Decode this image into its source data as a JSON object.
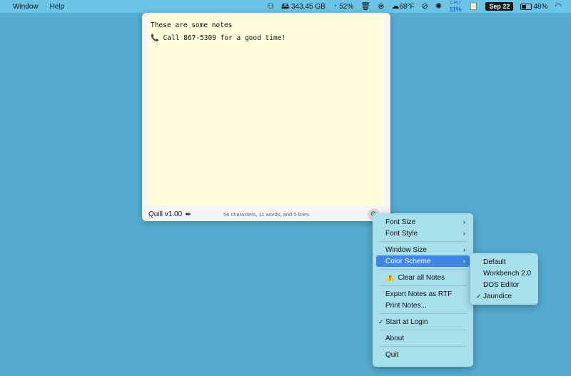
{
  "menubar": {
    "menus": [
      "Window",
      "Help"
    ],
    "disk": "343.45 GB",
    "cpu_percent": "52%",
    "temperature": "68°F",
    "cpu_label": "CPU",
    "cpu_value": "11%",
    "date": "Sep 22",
    "battery": "48%"
  },
  "notes": {
    "lines": [
      "These are some notes",
      "📞 Call 867-5309 for a good time!"
    ],
    "app_version": "Quill v1.00",
    "stats": "56 characters, 11 words, and 5 lines"
  },
  "menu": {
    "font_size": "Font Size",
    "font_style": "Font Style",
    "window_size": "Window Size",
    "color_scheme": "Color Scheme",
    "clear_all": "Clear all Notes",
    "export_rtf": "Export Notes as RTF",
    "print": "Print Notes...",
    "start_login": "Start at Login",
    "about": "About",
    "quit": "Quit"
  },
  "color_schemes": {
    "default": "Default",
    "workbench": "Workbench 2.0",
    "dos": "DOS Editor",
    "jaundice": "Jaundice"
  },
  "colors": {
    "desktop": "#55acd0",
    "menubar": "#6cc4e6",
    "notes_bg": "#fffddc",
    "menu_bg": "#aae1ec",
    "selection": "#3f86e8"
  }
}
